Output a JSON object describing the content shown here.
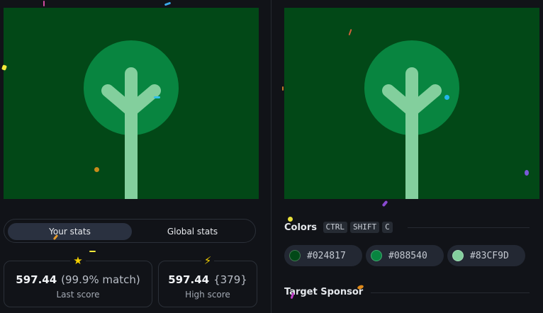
{
  "colors": {
    "background": "#024817",
    "circle": "#088540",
    "tree": "#83CF9D"
  },
  "tabs": [
    {
      "label": "Your stats",
      "active": true
    },
    {
      "label": "Global stats",
      "active": false
    }
  ],
  "stats": {
    "last": {
      "icon": "star-icon",
      "value": "597.44",
      "extra": "(99.9% match)",
      "label": "Last score"
    },
    "high": {
      "icon": "lightning-icon",
      "value": "597.44",
      "extra": "{379}",
      "label": "High score"
    }
  },
  "palette": {
    "title": "Colors",
    "shortcut": [
      "CTRL",
      "SHIFT",
      "C"
    ],
    "chips": [
      {
        "hex": "#024817"
      },
      {
        "hex": "#088540"
      },
      {
        "hex": "#83CF9D"
      }
    ]
  },
  "sponsor": {
    "title": "Target Sponsor"
  }
}
